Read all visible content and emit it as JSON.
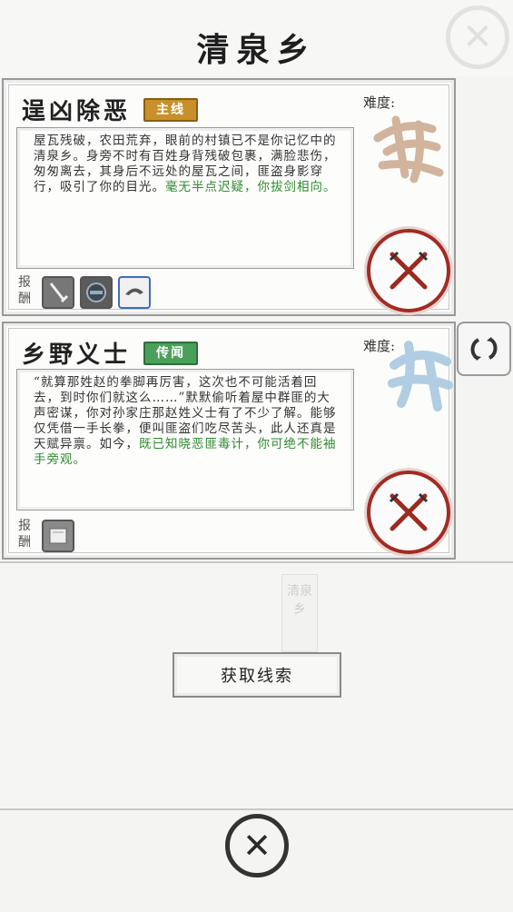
{
  "header": {
    "title": "清泉乡",
    "close_icon": "close-icon"
  },
  "quests": [
    {
      "title": "逞凶除恶",
      "tag": "主线",
      "tag_color": "#c8902a",
      "difficulty_label": "难度:",
      "difficulty_icon": "difficulty-hard-icon",
      "desc_normal": "屋瓦残破，农田荒弃，眼前的村镇已不是你记忆中的清泉乡。身旁不时有百姓身背残破包裹，满脸悲伤，匆匆离去，其身后不远处的屋瓦之间，匪盗身影穿行，吸引了你的目光。",
      "desc_green": "毫无半点迟疑，你拔剑相向。",
      "reward_label": "报酬",
      "rewards": [
        "sword-item-icon",
        "armor-item-icon",
        "helmet-item-icon"
      ]
    },
    {
      "title": "乡野义士",
      "tag": "传闻",
      "tag_color": "#4aa05a",
      "difficulty_label": "难度:",
      "difficulty_icon": "difficulty-medium-icon",
      "desc_normal": "“就算那姓赵的拳脚再厉害，这次也不可能活着回去，到时你们就这么……”默默偷听着屋中群匪的大声密谋，你对孙家庄那赵姓义士有了不少了解。能够仅凭借一手长拳，便叫匪盗们吃尽苦头，此人还真是天赋异禀。如今，",
      "desc_green": "既已知晓恶匪毒计，你可绝不能袖手旁观。",
      "reward_label": "报酬",
      "rewards": [
        "book-item-icon"
      ]
    }
  ],
  "refresh_icon": "refresh-icon",
  "clue_button": "获取线索",
  "faded_banner": "清泉乡",
  "bottom_close_icon": "close-icon"
}
